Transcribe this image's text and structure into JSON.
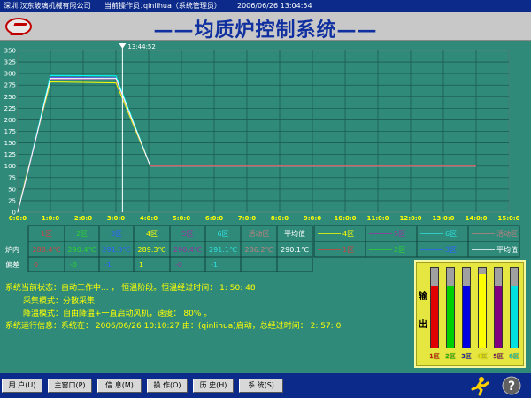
{
  "header": {
    "company": "深圳.汉东玻璃机械有限公司",
    "operator_label": "当前操作员：",
    "operator": "qinlihua（系统管理员）",
    "datetime": "2006/06/26  13:04:54",
    "title": "——均质炉控制系统——"
  },
  "chart_data": {
    "type": "line",
    "y_ticks": [
      "350",
      "325",
      "300",
      "275",
      "250",
      "225",
      "200",
      "175",
      "150",
      "125",
      "100",
      "75",
      "50",
      "25",
      "0"
    ],
    "x_ticks": [
      "0:0:0",
      "1:0:0",
      "2:0:0",
      "3:0:0",
      "4:0:0",
      "5:0:0",
      "6:0:0",
      "7:0:0",
      "8:0:0",
      "9:0:0",
      "10:0:0",
      "11:0:0",
      "12:0:0",
      "13:0:0",
      "14:0:0",
      "15:0:0"
    ],
    "ylim": [
      0,
      350
    ],
    "xlim": [
      0,
      15
    ],
    "cursor_label": "13:44:52",
    "cursor_x": 3.2,
    "grid": true,
    "series": [
      {
        "color": "#ffff00",
        "x": [
          0,
          0.25,
          1.0,
          3.0,
          4.05,
          14.0
        ],
        "y": [
          0,
          75,
          282,
          280,
          100,
          100
        ]
      },
      {
        "color": "#4040ff",
        "x": [
          0,
          0.25,
          1.0,
          3.0,
          4.05,
          14.0
        ],
        "y": [
          0,
          72,
          292,
          291,
          100,
          100
        ]
      },
      {
        "color": "#00ffff",
        "x": [
          0,
          0.25,
          1.0,
          3.0,
          4.05,
          14.0
        ],
        "y": [
          0,
          70,
          296,
          295,
          100,
          100
        ]
      },
      {
        "color": "#c080c0",
        "x": [
          0,
          0.25,
          1.0,
          3.0,
          4.05,
          14.0
        ],
        "y": [
          0,
          68,
          288,
          287,
          100,
          100
        ]
      },
      {
        "color": "#ffffff",
        "x": [
          0,
          0.25,
          1.0,
          3.0,
          4.05,
          14.0
        ],
        "y": [
          0,
          71,
          290,
          290,
          100,
          100
        ]
      },
      {
        "color": "#d04040",
        "x": [
          4.05,
          14.0
        ],
        "y": [
          100,
          100
        ]
      }
    ]
  },
  "zone_table": {
    "headers": [
      "1区",
      "2区",
      "3区",
      "4区",
      "5区",
      "6区",
      "活动区",
      "平均值"
    ],
    "header_colors": [
      "#d04040",
      "#30d030",
      "#3060ff",
      "#ffff00",
      "#a030a0",
      "#30e0e0",
      "#c08080",
      "#ffffff"
    ],
    "row_labels": [
      "炉内",
      "偏差"
    ],
    "furnace": [
      "288.4℃",
      "290.4℃",
      "291.3℃",
      "289.3℃",
      "290.4℃",
      "291.1℃",
      "286.2℃",
      "290.1℃"
    ],
    "deviation": [
      "0",
      "-0",
      "-1",
      "1",
      "-0",
      "-1"
    ]
  },
  "legend": [
    {
      "label": "4区",
      "color": "#ffff00"
    },
    {
      "label": "5区",
      "color": "#a030a0"
    },
    {
      "label": "6区",
      "color": "#30e0e0"
    },
    {
      "label": "活动区",
      "color": "#c08080"
    },
    {
      "label": "1区",
      "color": "#d04040"
    },
    {
      "label": "2区",
      "color": "#30d030"
    },
    {
      "label": "3区",
      "color": "#3060ff"
    },
    {
      "label": "平均值",
      "color": "#ffffff"
    }
  ],
  "status": {
    "line1": "系统当前状态：自动工作中...    ，  恒温阶段。恒温经过时间： 1: 50: 48",
    "line2": "采集模式：分散采集",
    "line3": "降温模式：自由降温+一直启动风机，速度： 80% 。",
    "line4": "系统运行信息：系统在： 2006/06/26 10:10:27 由：(qinlihua)启动，总经过时间： 2: 57: 0"
  },
  "output_panel": {
    "label_top": "输",
    "label_bottom": "出",
    "zones": [
      {
        "label": "1区",
        "color": "#e00000",
        "level": 0.78
      },
      {
        "label": "2区",
        "color": "#00d000",
        "level": 0.78
      },
      {
        "label": "3区",
        "color": "#0000e0",
        "level": 0.78
      },
      {
        "label": "4区",
        "color": "#ffff00",
        "level": 0.92
      },
      {
        "label": "5区",
        "color": "#800080",
        "level": 0.78
      },
      {
        "label": "6区",
        "color": "#00e0e0",
        "level": 0.78
      }
    ]
  },
  "toolbar": {
    "buttons": [
      "用 户(U)",
      "主窗口(P)",
      "信 息(M)",
      "操 作(O)",
      "历 史(H)",
      "系 统(S)"
    ]
  }
}
